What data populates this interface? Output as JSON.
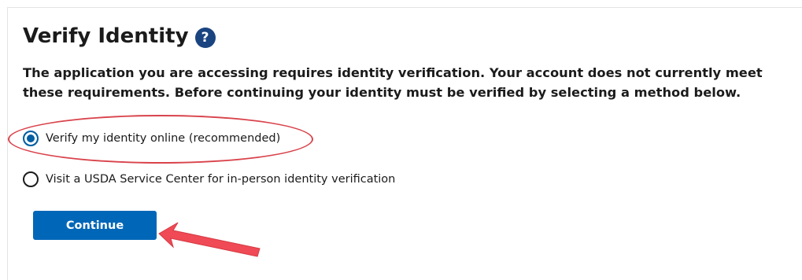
{
  "page": {
    "title": "Verify Identity",
    "help_icon": "question-mark-icon",
    "help_glyph": "?",
    "description": "The application you are accessing requires identity verification. Your account does not currently meet these requirements. Before continuing your identity must be verified by selecting a method below."
  },
  "options": [
    {
      "label": "Verify my identity online (recommended)",
      "selected": true
    },
    {
      "label": "Visit a USDA Service Center for in-person identity verification",
      "selected": false
    }
  ],
  "actions": {
    "continue_label": "Continue"
  },
  "annotations": {
    "highlight_color": "#d9434b",
    "arrow_color": "#ef4a55"
  },
  "colors": {
    "primary": "#005ea2",
    "button": "#0067b8",
    "help_icon_bg": "#1a4480",
    "text": "#1b1b1b"
  }
}
